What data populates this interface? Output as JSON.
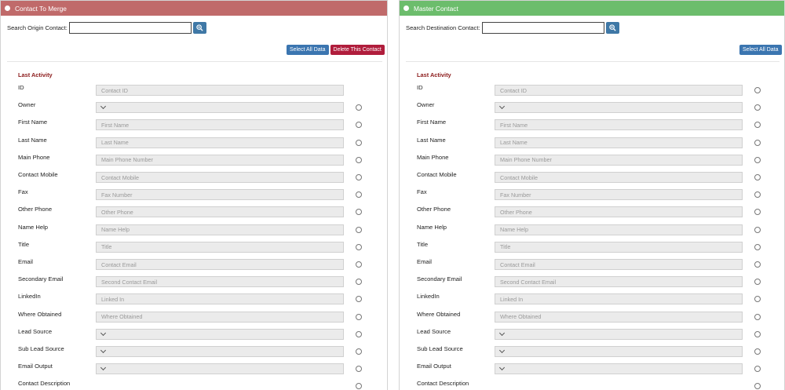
{
  "merge_panel": {
    "title": "Contact To Merge",
    "search_label": "Search Origin Contact:",
    "search_value": "",
    "select_all_label": "Select All Data",
    "delete_label": "Delete This Contact",
    "section_title": "Last Activity"
  },
  "master_panel": {
    "title": "Master Contact",
    "search_label": "Search Destination Contact:",
    "search_value": "",
    "select_all_label": "Select All Data",
    "section_title": "Last Activity"
  },
  "fields": [
    {
      "label": "ID",
      "placeholder": "Contact ID",
      "select": false,
      "merge_radio": false
    },
    {
      "label": "Owner",
      "placeholder": "",
      "select": true,
      "merge_radio": true
    },
    {
      "label": "First Name",
      "placeholder": "First Name",
      "select": false,
      "merge_radio": true
    },
    {
      "label": "Last Name",
      "placeholder": "Last Name",
      "select": false,
      "merge_radio": true
    },
    {
      "label": "Main Phone",
      "placeholder": "Main Phone Number",
      "select": false,
      "merge_radio": true
    },
    {
      "label": "Contact Mobile",
      "placeholder": "Contact Mobile",
      "select": false,
      "merge_radio": true
    },
    {
      "label": "Fax",
      "placeholder": "Fax Number",
      "select": false,
      "merge_radio": true
    },
    {
      "label": "Other Phone",
      "placeholder": "Other Phone",
      "select": false,
      "merge_radio": true
    },
    {
      "label": "Name Help",
      "placeholder": "Name Help",
      "select": false,
      "merge_radio": true
    },
    {
      "label": "Title",
      "placeholder": "Title",
      "select": false,
      "merge_radio": true
    },
    {
      "label": "Email",
      "placeholder": "Contact Email",
      "select": false,
      "merge_radio": true
    },
    {
      "label": "Secondary Email",
      "placeholder": "Second Contact Email",
      "select": false,
      "merge_radio": true
    },
    {
      "label": "LinkedIn",
      "placeholder": "Linked In",
      "select": false,
      "merge_radio": true
    },
    {
      "label": "Where Obtained",
      "placeholder": "Where Obtained",
      "select": false,
      "merge_radio": true
    },
    {
      "label": "Lead Source",
      "placeholder": "",
      "select": true,
      "merge_radio": true
    },
    {
      "label": "Sub Lead Source",
      "placeholder": "",
      "select": true,
      "merge_radio": true
    },
    {
      "label": "Email Output",
      "placeholder": "",
      "select": true,
      "merge_radio": true
    }
  ],
  "description_label": "Contact Description",
  "icons": {
    "header": "circle-icon",
    "search": "magnifier-icon",
    "select": "chevron-down-icon",
    "option": "radio-icon"
  },
  "colors": {
    "merge_header": "#c06a6a",
    "master_header": "#6cbd6c",
    "section_title": "#8b1a1a",
    "select_all_button": "#3b75b0",
    "delete_button": "#b01d3c",
    "search_button": "#3f78a6"
  }
}
